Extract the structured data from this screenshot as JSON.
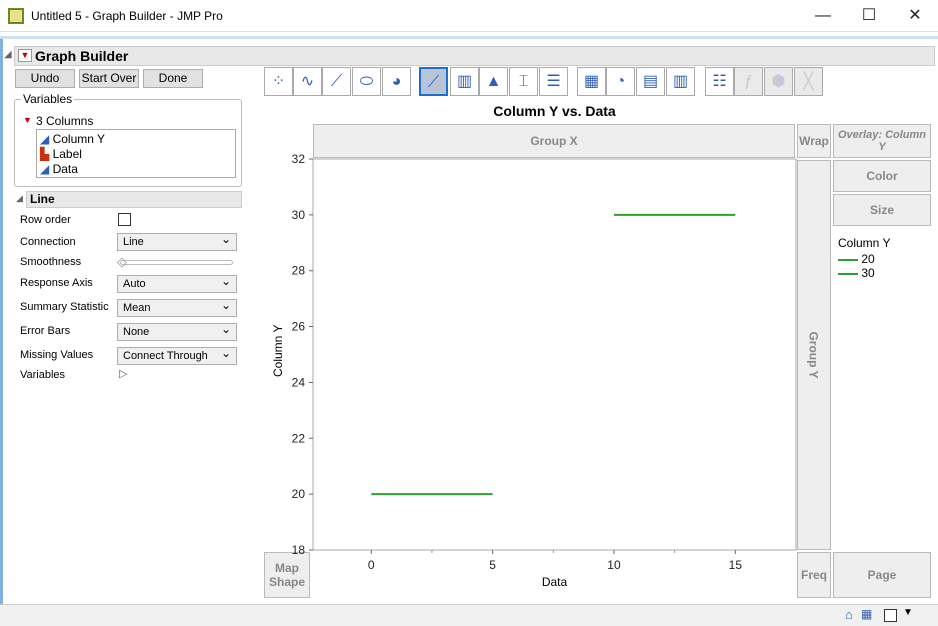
{
  "window": {
    "title": "Untitled 5 - Graph Builder - JMP Pro",
    "minimize": "—",
    "maximize": "☐",
    "close": "✕"
  },
  "panel": {
    "title": "Graph Builder"
  },
  "buttons": {
    "undo": "Undo",
    "start_over": "Start Over",
    "done": "Done"
  },
  "variables": {
    "legend": "Variables",
    "group": "3 Columns",
    "columns": [
      "Column Y",
      "Label",
      "Data"
    ]
  },
  "line_section": {
    "title": "Line",
    "row_order": "Row order",
    "connection": "Connection",
    "connection_value": "Line",
    "smoothness": "Smoothness",
    "smoothness_value": 0,
    "response_axis": "Response Axis",
    "response_axis_value": "Auto",
    "summary_statistic": "Summary Statistic",
    "summary_statistic_value": "Mean",
    "error_bars": "Error Bars",
    "error_bars_value": "None",
    "missing_values": "Missing Values",
    "missing_values_value": "Connect Through",
    "variables": "Variables"
  },
  "zones": {
    "group_x": "Group X",
    "wrap": "Wrap",
    "overlay": "Overlay: Column Y",
    "color": "Color",
    "size": "Size",
    "group_y": "Group Y",
    "map_shape": "Map Shape",
    "freq": "Freq",
    "page": "Page"
  },
  "legend": {
    "title": "Column Y",
    "items": [
      "20",
      "30"
    ],
    "color": "#2ca02c"
  },
  "chart_data": {
    "type": "line",
    "title": "Column Y vs. Data",
    "xlabel": "Data",
    "ylabel": "Column Y",
    "xlim": [
      -2.4,
      17.5
    ],
    "ylim": [
      18,
      32
    ],
    "xticks": [
      "0",
      "5",
      "10",
      "15"
    ],
    "yticks": [
      "18",
      "20",
      "22",
      "24",
      "26",
      "28",
      "30",
      "32"
    ],
    "series": [
      {
        "name": "20",
        "x": [
          0,
          5
        ],
        "y": [
          20,
          20
        ]
      },
      {
        "name": "30",
        "x": [
          10,
          15
        ],
        "y": [
          30,
          30
        ]
      }
    ],
    "color": "#2ca02c"
  }
}
